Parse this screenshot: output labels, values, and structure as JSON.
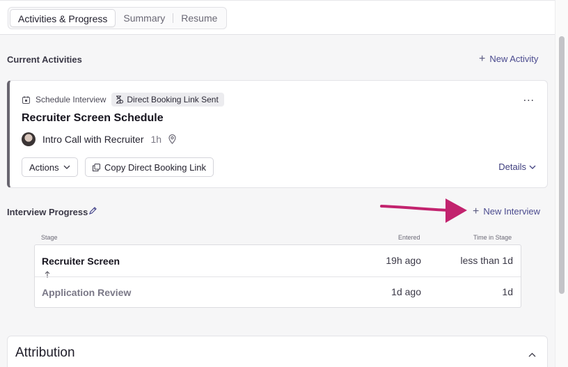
{
  "tabs": [
    {
      "label": "Activities & Progress",
      "active": true
    },
    {
      "label": "Summary",
      "active": false
    },
    {
      "label": "Resume",
      "active": false
    }
  ],
  "current_activities": {
    "title": "Current Activities",
    "new_activity_label": "New Activity"
  },
  "activity_card": {
    "type_label": "Schedule Interview",
    "status_badge": "Direct Booking Link Sent",
    "title": "Recruiter Screen Schedule",
    "event_name": "Intro Call with Recruiter",
    "duration": "1h",
    "actions_label": "Actions",
    "copy_link_label": "Copy Direct Booking Link",
    "details_label": "Details",
    "more_label": "..."
  },
  "interview_progress": {
    "title": "Interview Progress",
    "new_interview_label": "New Interview",
    "columns": {
      "stage": "Stage",
      "entered": "Entered",
      "time_in_stage": "Time in Stage"
    },
    "rows": [
      {
        "stage": "Recruiter Screen",
        "entered": "19h ago",
        "time_in_stage": "less than 1d",
        "current": true
      },
      {
        "stage": "Application Review",
        "entered": "1d ago",
        "time_in_stage": "1d",
        "current": false
      }
    ]
  },
  "attribution": {
    "title": "Attribution"
  },
  "colors": {
    "accent_link": "#4a4a8e",
    "annotation_arrow": "#c2236e",
    "current_stage_text": "#17151f",
    "past_stage_text": "#7a7887"
  }
}
